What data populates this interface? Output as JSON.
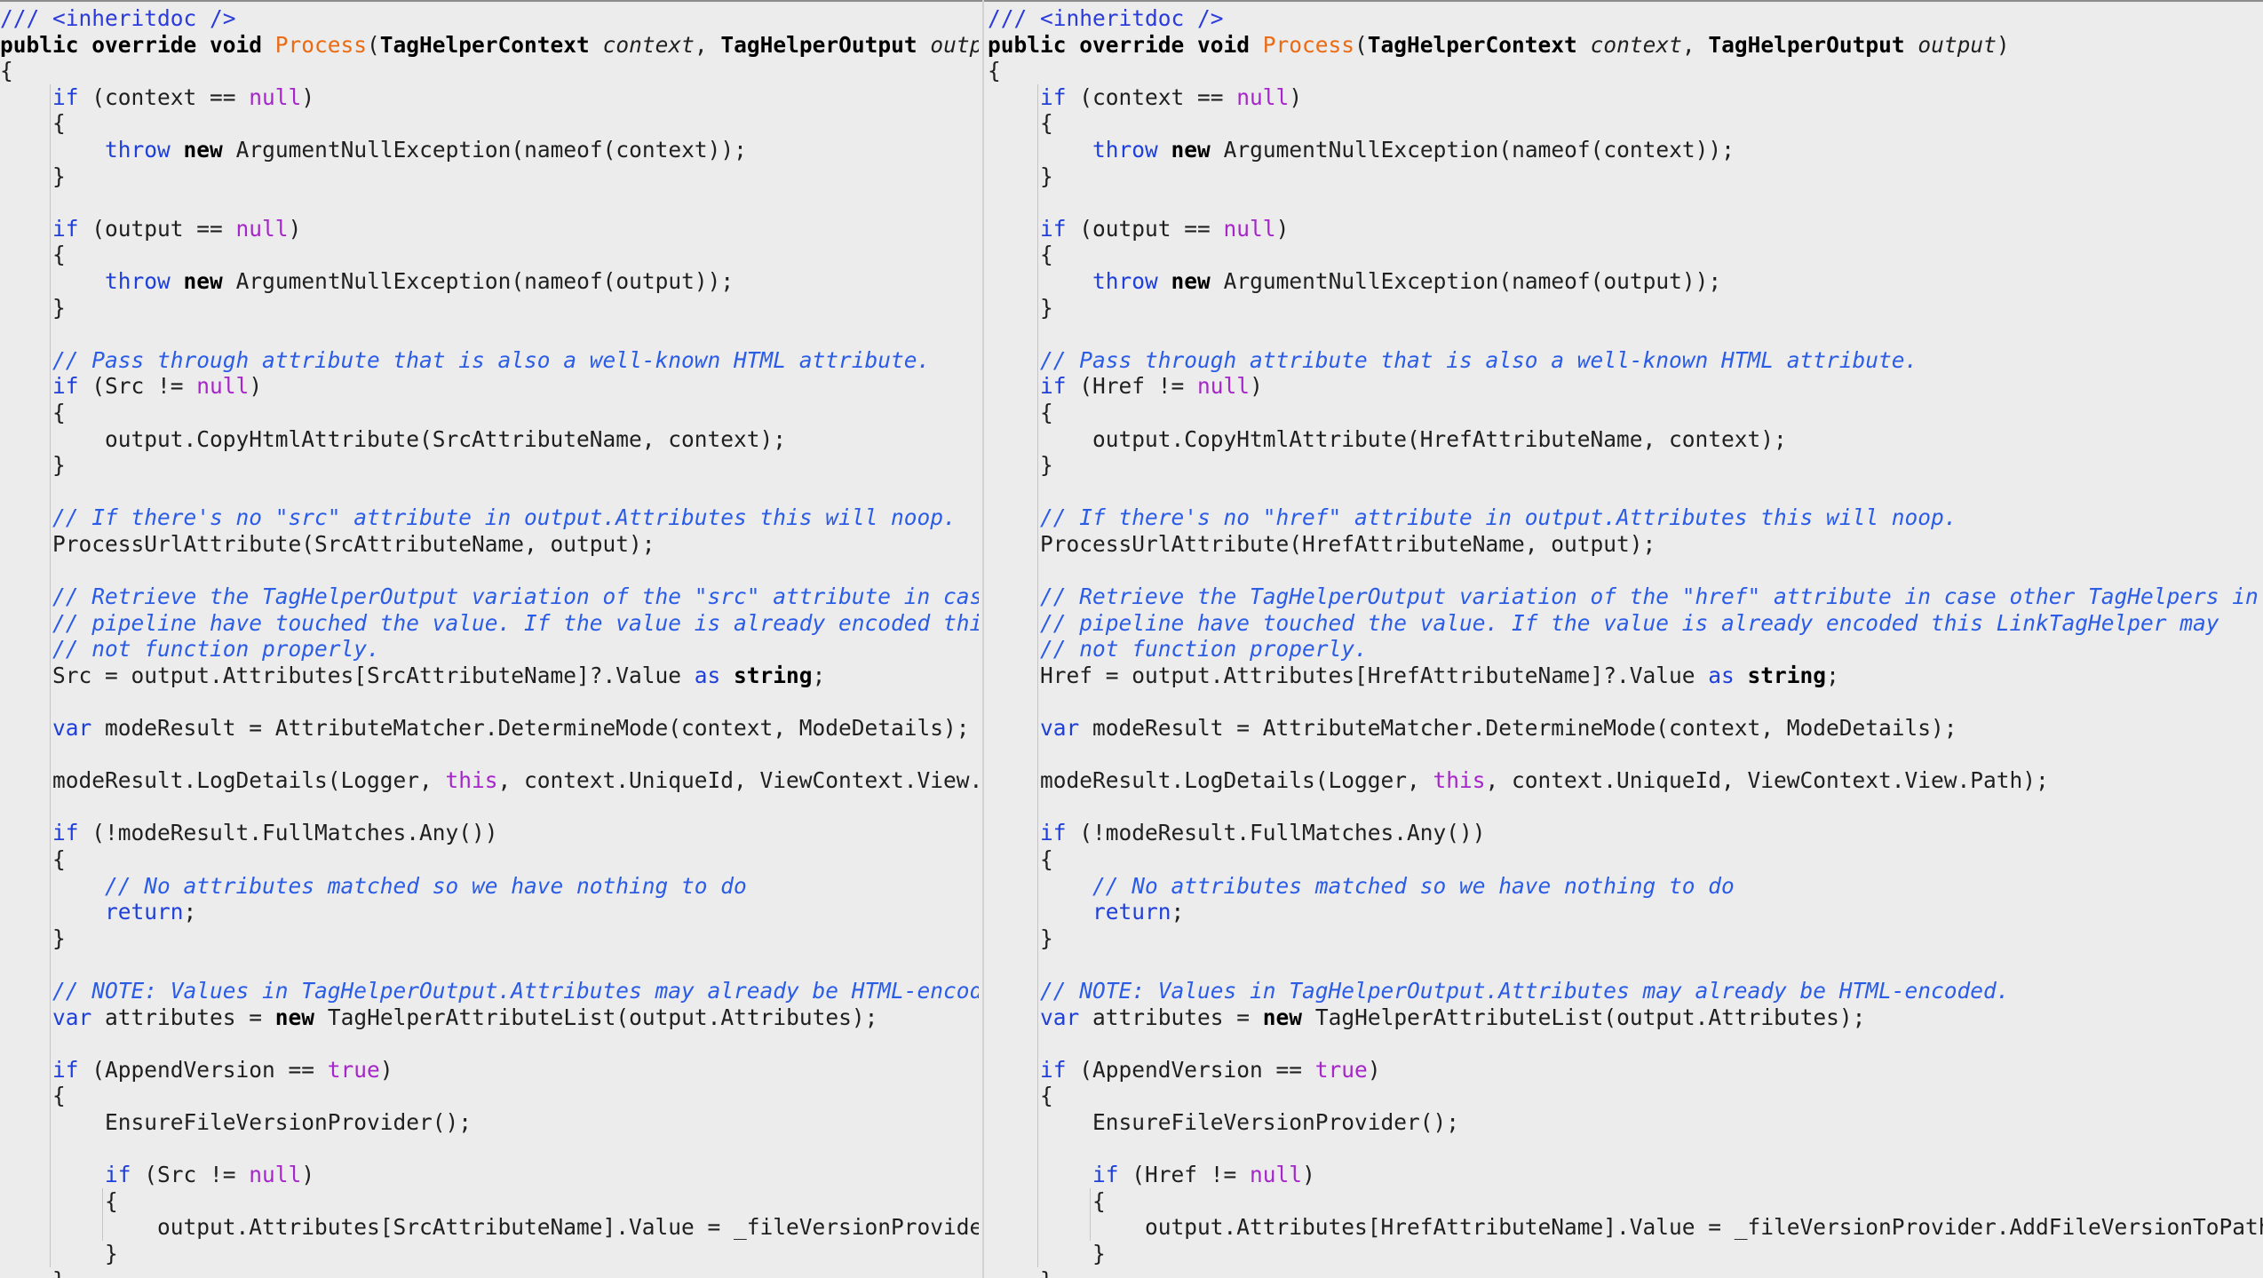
{
  "panes": [
    {
      "name": "code-pane-left",
      "lines": [
        [
          [
            "doc",
            "/// <inheritdoc />"
          ]
        ],
        [
          [
            "kwb",
            "public override void "
          ],
          [
            "meth",
            "Process"
          ],
          [
            "pl",
            "("
          ],
          [
            "ty",
            "TagHelperContext"
          ],
          [
            "pl",
            " "
          ],
          [
            "par",
            "context"
          ],
          [
            "pl",
            ", "
          ],
          [
            "ty",
            "TagHelperOutput"
          ],
          [
            "pl",
            " "
          ],
          [
            "par",
            "output"
          ],
          [
            "pl",
            ")"
          ]
        ],
        [
          [
            "pl",
            "{"
          ]
        ],
        [
          [
            "pl",
            "    "
          ],
          [
            "kw",
            "if"
          ],
          [
            "pl",
            " (context == "
          ],
          [
            "lit",
            "null"
          ],
          [
            "pl",
            ")"
          ]
        ],
        [
          [
            "pl",
            "    {"
          ]
        ],
        [
          [
            "pl",
            "        "
          ],
          [
            "kw",
            "throw"
          ],
          [
            "pl",
            " "
          ],
          [
            "kwb",
            "new"
          ],
          [
            "pl",
            " ArgumentNullException(nameof(context));"
          ]
        ],
        [
          [
            "pl",
            "    }"
          ]
        ],
        [],
        [
          [
            "pl",
            "    "
          ],
          [
            "kw",
            "if"
          ],
          [
            "pl",
            " (output == "
          ],
          [
            "lit",
            "null"
          ],
          [
            "pl",
            ")"
          ]
        ],
        [
          [
            "pl",
            "    {"
          ]
        ],
        [
          [
            "pl",
            "        "
          ],
          [
            "kw",
            "throw"
          ],
          [
            "pl",
            " "
          ],
          [
            "kwb",
            "new"
          ],
          [
            "pl",
            " ArgumentNullException(nameof(output));"
          ]
        ],
        [
          [
            "pl",
            "    }"
          ]
        ],
        [],
        [
          [
            "pl",
            "    "
          ],
          [
            "cm",
            "// Pass through attribute that is also a well-known HTML attribute."
          ]
        ],
        [
          [
            "pl",
            "    "
          ],
          [
            "kw",
            "if"
          ],
          [
            "pl",
            " (Src != "
          ],
          [
            "lit",
            "null"
          ],
          [
            "pl",
            ")"
          ]
        ],
        [
          [
            "pl",
            "    {"
          ]
        ],
        [
          [
            "pl",
            "        output.CopyHtmlAttribute(SrcAttributeName, context);"
          ]
        ],
        [
          [
            "pl",
            "    }"
          ]
        ],
        [],
        [
          [
            "pl",
            "    "
          ],
          [
            "cm",
            "// If there's no \"src\" attribute in output.Attributes this will noop."
          ]
        ],
        [
          [
            "pl",
            "    ProcessUrlAttribute(SrcAttributeName, output);"
          ]
        ],
        [],
        [
          [
            "pl",
            "    "
          ],
          [
            "cm",
            "// Retrieve the TagHelperOutput variation of the \"src\" attribute in case othe"
          ]
        ],
        [
          [
            "pl",
            "    "
          ],
          [
            "cm",
            "// pipeline have touched the value. If the value is already encoded this Scr"
          ]
        ],
        [
          [
            "pl",
            "    "
          ],
          [
            "cm",
            "// not function properly."
          ]
        ],
        [
          [
            "pl",
            "    Src = output.Attributes[SrcAttributeName]?.Value "
          ],
          [
            "kw",
            "as"
          ],
          [
            "pl",
            " "
          ],
          [
            "kwb",
            "string"
          ],
          [
            "pl",
            ";"
          ]
        ],
        [],
        [
          [
            "pl",
            "    "
          ],
          [
            "kw",
            "var"
          ],
          [
            "pl",
            " modeResult = AttributeMatcher.DetermineMode(context, ModeDetails);"
          ]
        ],
        [],
        [
          [
            "pl",
            "    modeResult.LogDetails(Logger, "
          ],
          [
            "lit",
            "this"
          ],
          [
            "pl",
            ", context.UniqueId, ViewContext.View.Path);"
          ]
        ],
        [],
        [
          [
            "pl",
            "    "
          ],
          [
            "kw",
            "if"
          ],
          [
            "pl",
            " (!modeResult.FullMatches.Any())"
          ]
        ],
        [
          [
            "pl",
            "    {"
          ]
        ],
        [
          [
            "pl",
            "        "
          ],
          [
            "cm",
            "// No attributes matched so we have nothing to do"
          ]
        ],
        [
          [
            "pl",
            "        "
          ],
          [
            "kw",
            "return"
          ],
          [
            "pl",
            ";"
          ]
        ],
        [
          [
            "pl",
            "    }"
          ]
        ],
        [],
        [
          [
            "pl",
            "    "
          ],
          [
            "cm",
            "// NOTE: Values in TagHelperOutput.Attributes may already be HTML-encoded."
          ]
        ],
        [
          [
            "pl",
            "    "
          ],
          [
            "kw",
            "var"
          ],
          [
            "pl",
            " attributes = "
          ],
          [
            "kwb",
            "new"
          ],
          [
            "pl",
            " TagHelperAttributeList(output.Attributes);"
          ]
        ],
        [],
        [
          [
            "pl",
            "    "
          ],
          [
            "kw",
            "if"
          ],
          [
            "pl",
            " (AppendVersion == "
          ],
          [
            "lit",
            "true"
          ],
          [
            "pl",
            ")"
          ]
        ],
        [
          [
            "pl",
            "    {"
          ]
        ],
        [
          [
            "pl",
            "        EnsureFileVersionProvider();"
          ]
        ],
        [],
        [
          [
            "pl",
            "        "
          ],
          [
            "kw",
            "if"
          ],
          [
            "pl",
            " (Src != "
          ],
          [
            "lit",
            "null"
          ],
          [
            "pl",
            ")"
          ]
        ],
        [
          [
            "pl",
            "        {"
          ]
        ],
        [
          [
            "pl",
            "            output.Attributes[SrcAttributeName].Value = _fileVersionProvider.AddF"
          ]
        ],
        [
          [
            "pl",
            "        }"
          ]
        ],
        [
          [
            "pl",
            "    }"
          ]
        ]
      ]
    },
    {
      "name": "code-pane-right",
      "lines": [
        [
          [
            "doc",
            "/// <inheritdoc />"
          ]
        ],
        [
          [
            "kwb",
            "public override void "
          ],
          [
            "meth",
            "Process"
          ],
          [
            "pl",
            "("
          ],
          [
            "ty",
            "TagHelperContext"
          ],
          [
            "pl",
            " "
          ],
          [
            "par",
            "context"
          ],
          [
            "pl",
            ", "
          ],
          [
            "ty",
            "TagHelperOutput"
          ],
          [
            "pl",
            " "
          ],
          [
            "par",
            "output"
          ],
          [
            "pl",
            ")"
          ]
        ],
        [
          [
            "pl",
            "{"
          ]
        ],
        [
          [
            "pl",
            "    "
          ],
          [
            "kw",
            "if"
          ],
          [
            "pl",
            " (context == "
          ],
          [
            "lit",
            "null"
          ],
          [
            "pl",
            ")"
          ]
        ],
        [
          [
            "pl",
            "    {"
          ]
        ],
        [
          [
            "pl",
            "        "
          ],
          [
            "kw",
            "throw"
          ],
          [
            "pl",
            " "
          ],
          [
            "kwb",
            "new"
          ],
          [
            "pl",
            " ArgumentNullException(nameof(context));"
          ]
        ],
        [
          [
            "pl",
            "    }"
          ]
        ],
        [],
        [
          [
            "pl",
            "    "
          ],
          [
            "kw",
            "if"
          ],
          [
            "pl",
            " (output == "
          ],
          [
            "lit",
            "null"
          ],
          [
            "pl",
            ")"
          ]
        ],
        [
          [
            "pl",
            "    {"
          ]
        ],
        [
          [
            "pl",
            "        "
          ],
          [
            "kw",
            "throw"
          ],
          [
            "pl",
            " "
          ],
          [
            "kwb",
            "new"
          ],
          [
            "pl",
            " ArgumentNullException(nameof(output));"
          ]
        ],
        [
          [
            "pl",
            "    }"
          ]
        ],
        [],
        [
          [
            "pl",
            "    "
          ],
          [
            "cm",
            "// Pass through attribute that is also a well-known HTML attribute."
          ]
        ],
        [
          [
            "pl",
            "    "
          ],
          [
            "kw",
            "if"
          ],
          [
            "pl",
            " (Href != "
          ],
          [
            "lit",
            "null"
          ],
          [
            "pl",
            ")"
          ]
        ],
        [
          [
            "pl",
            "    {"
          ]
        ],
        [
          [
            "pl",
            "        output.CopyHtmlAttribute(HrefAttributeName, context);"
          ]
        ],
        [
          [
            "pl",
            "    }"
          ]
        ],
        [],
        [
          [
            "pl",
            "    "
          ],
          [
            "cm",
            "// If there's no \"href\" attribute in output.Attributes this will noop."
          ]
        ],
        [
          [
            "pl",
            "    ProcessUrlAttribute(HrefAttributeName, output);"
          ]
        ],
        [],
        [
          [
            "pl",
            "    "
          ],
          [
            "cm",
            "// Retrieve the TagHelperOutput variation of the \"href\" attribute in case other TagHelpers in the"
          ]
        ],
        [
          [
            "pl",
            "    "
          ],
          [
            "cm",
            "// pipeline have touched the value. If the value is already encoded this LinkTagHelper may"
          ]
        ],
        [
          [
            "pl",
            "    "
          ],
          [
            "cm",
            "// not function properly."
          ]
        ],
        [
          [
            "pl",
            "    Href = output.Attributes[HrefAttributeName]?.Value "
          ],
          [
            "kw",
            "as"
          ],
          [
            "pl",
            " "
          ],
          [
            "kwb",
            "string"
          ],
          [
            "pl",
            ";"
          ]
        ],
        [],
        [
          [
            "pl",
            "    "
          ],
          [
            "kw",
            "var"
          ],
          [
            "pl",
            " modeResult = AttributeMatcher.DetermineMode(context, ModeDetails);"
          ]
        ],
        [],
        [
          [
            "pl",
            "    modeResult.LogDetails(Logger, "
          ],
          [
            "lit",
            "this"
          ],
          [
            "pl",
            ", context.UniqueId, ViewContext.View.Path);"
          ]
        ],
        [],
        [
          [
            "pl",
            "    "
          ],
          [
            "kw",
            "if"
          ],
          [
            "pl",
            " (!modeResult.FullMatches.Any())"
          ]
        ],
        [
          [
            "pl",
            "    {"
          ]
        ],
        [
          [
            "pl",
            "        "
          ],
          [
            "cm",
            "// No attributes matched so we have nothing to do"
          ]
        ],
        [
          [
            "pl",
            "        "
          ],
          [
            "kw",
            "return"
          ],
          [
            "pl",
            ";"
          ]
        ],
        [
          [
            "pl",
            "    }"
          ]
        ],
        [],
        [
          [
            "pl",
            "    "
          ],
          [
            "cm",
            "// NOTE: Values in TagHelperOutput.Attributes may already be HTML-encoded."
          ]
        ],
        [
          [
            "pl",
            "    "
          ],
          [
            "kw",
            "var"
          ],
          [
            "pl",
            " attributes = "
          ],
          [
            "kwb",
            "new"
          ],
          [
            "pl",
            " TagHelperAttributeList(output.Attributes);"
          ]
        ],
        [],
        [
          [
            "pl",
            "    "
          ],
          [
            "kw",
            "if"
          ],
          [
            "pl",
            " (AppendVersion == "
          ],
          [
            "lit",
            "true"
          ],
          [
            "pl",
            ")"
          ]
        ],
        [
          [
            "pl",
            "    {"
          ]
        ],
        [
          [
            "pl",
            "        EnsureFileVersionProvider();"
          ]
        ],
        [],
        [
          [
            "pl",
            "        "
          ],
          [
            "kw",
            "if"
          ],
          [
            "pl",
            " (Href != "
          ],
          [
            "lit",
            "null"
          ],
          [
            "pl",
            ")"
          ]
        ],
        [
          [
            "pl",
            "        {"
          ]
        ],
        [
          [
            "pl",
            "            output.Attributes[HrefAttributeName].Value = _fileVersionProvider.AddFileVersionToPath(Href);"
          ]
        ],
        [
          [
            "pl",
            "        }"
          ]
        ],
        [
          [
            "pl",
            "    }"
          ]
        ]
      ]
    }
  ],
  "colors": {
    "background": "#ececec",
    "keyword": "#1e3fd9",
    "literal": "#a526c9",
    "comment": "#2b5ce6",
    "method": "#ea6b14",
    "plain": "#1f1f1f"
  }
}
